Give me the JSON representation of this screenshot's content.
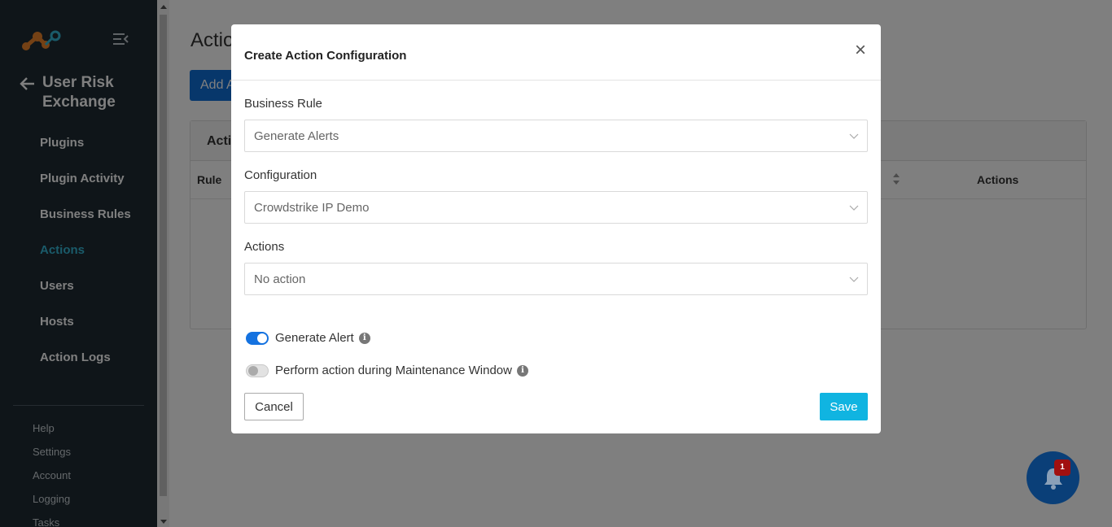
{
  "sidebar": {
    "logo": "network-logo",
    "app_title": "User Risk Exchange",
    "nav_items": [
      {
        "label": "Plugins",
        "active": false
      },
      {
        "label": "Plugin Activity",
        "active": false
      },
      {
        "label": "Business Rules",
        "active": false
      },
      {
        "label": "Actions",
        "active": true
      },
      {
        "label": "Users",
        "active": false
      },
      {
        "label": "Hosts",
        "active": false
      },
      {
        "label": "Action Logs",
        "active": false
      }
    ],
    "sub_items": [
      "Help",
      "Settings",
      "Account",
      "Logging",
      "Tasks"
    ]
  },
  "page": {
    "title": "Actio",
    "add_button": "Add A",
    "card_title": "Actio",
    "columns": {
      "rule": "Rule",
      "actions": "Actions"
    }
  },
  "modal": {
    "title": "Create Action Configuration",
    "close_symbol": "×",
    "business_rule": {
      "label": "Business Rule",
      "value": "Generate Alerts"
    },
    "configuration": {
      "label": "Configuration",
      "value": "Crowdstrike IP Demo"
    },
    "actions": {
      "label": "Actions",
      "value": "No action"
    },
    "generate_alert": {
      "label": "Generate Alert",
      "enabled": true
    },
    "maintenance_window": {
      "label": "Perform action during Maintenance Window",
      "enabled": false
    },
    "cancel_label": "Cancel",
    "save_label": "Save"
  },
  "notifications": {
    "count": "1"
  },
  "colors": {
    "sidebar_bg": "#1e2a33",
    "active_nav": "#35b6d4",
    "primary": "#0f6fd6",
    "save_button": "#10b4e1",
    "toggle_on": "#1472e0",
    "bell_button": "#0a3f78",
    "badge": "#a11010"
  }
}
